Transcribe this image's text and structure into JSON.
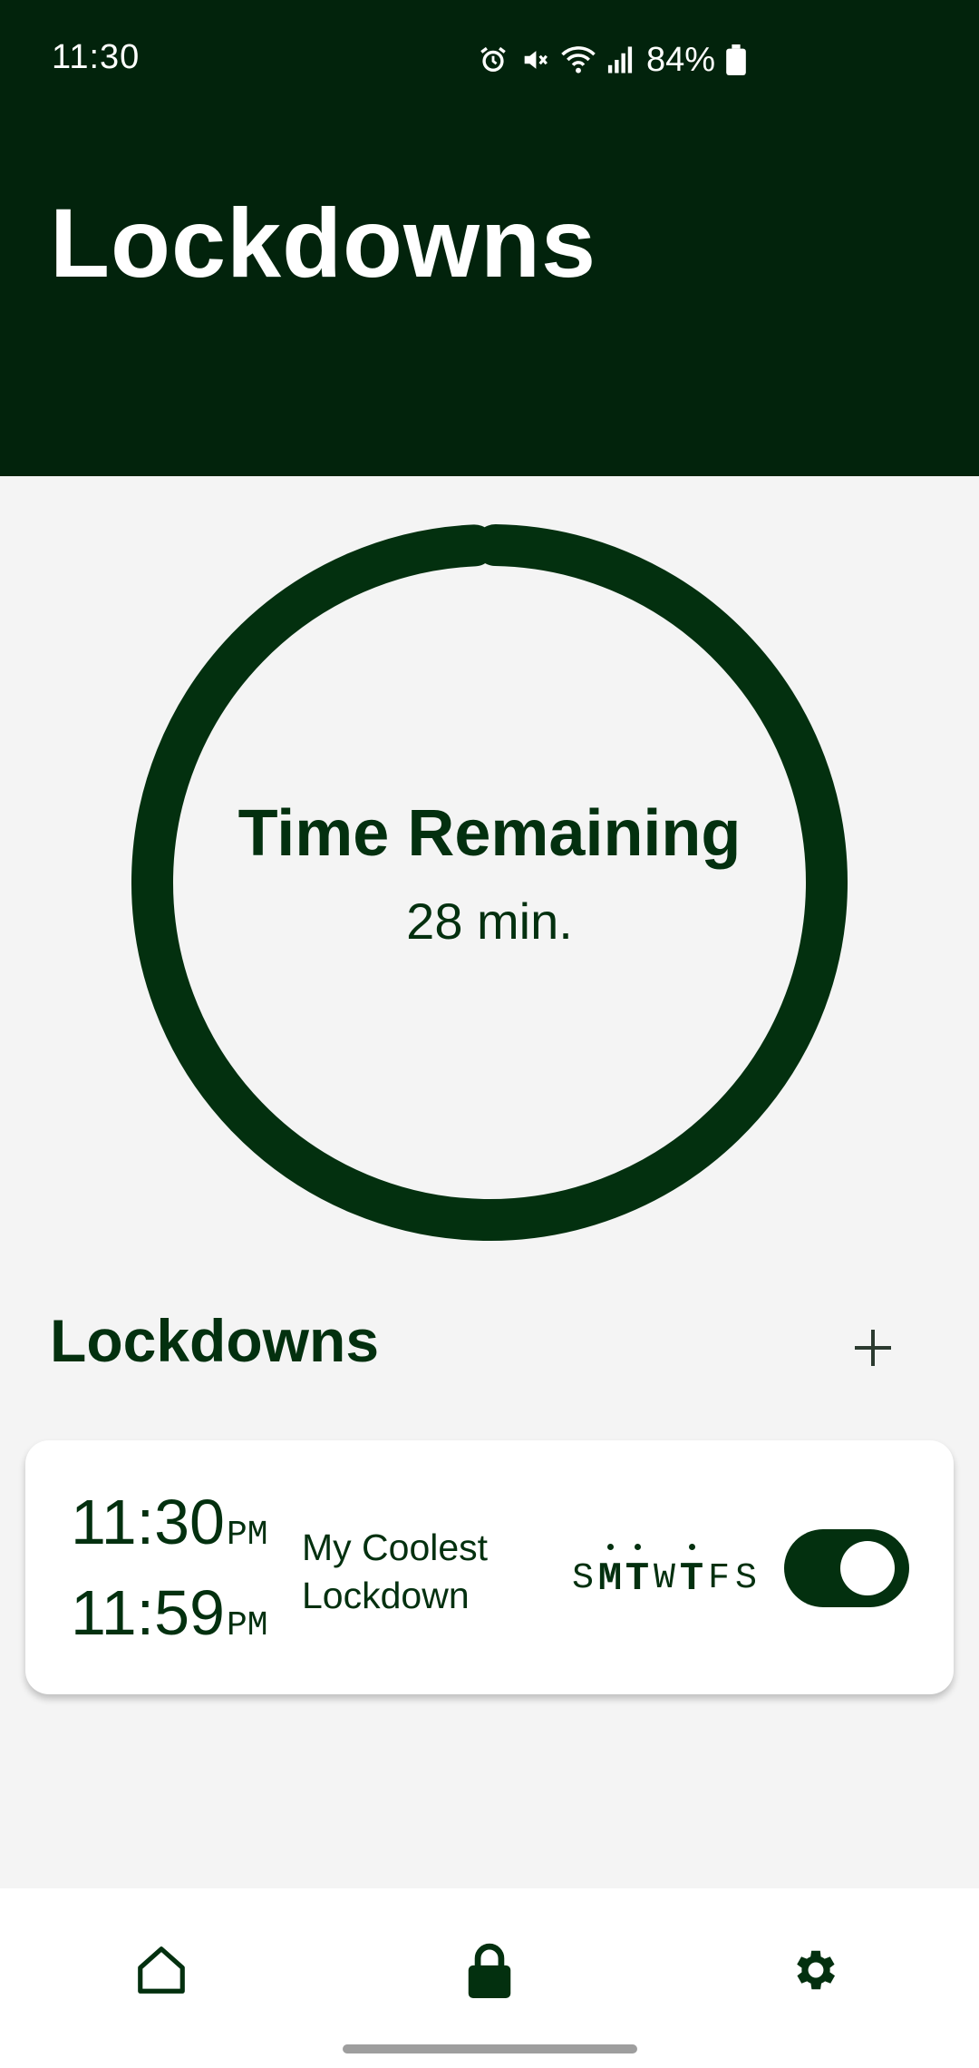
{
  "status_bar": {
    "time": "11:30",
    "battery": "84%",
    "icons": [
      "alarm-icon",
      "mute-icon",
      "wifi-icon",
      "signal-icon",
      "battery-icon"
    ]
  },
  "header": {
    "title": "Lockdowns"
  },
  "timer": {
    "title": "Time Remaining",
    "value": "28 min.",
    "progress": 0.99
  },
  "section": {
    "title": "Lockdowns",
    "add_icon": "plus-icon"
  },
  "lockdown": {
    "start_time": "11:30",
    "start_period": "PM",
    "end_time": "11:59",
    "end_period": "PM",
    "name_line1": "My Coolest",
    "name_line2": "Lockdown",
    "days": [
      {
        "label": "S",
        "active": false
      },
      {
        "label": "M",
        "active": true
      },
      {
        "label": "T",
        "active": true
      },
      {
        "label": "W",
        "active": false
      },
      {
        "label": "T",
        "active": true
      },
      {
        "label": "F",
        "active": false
      },
      {
        "label": "S",
        "active": false
      }
    ],
    "enabled": true
  },
  "bottom_nav": {
    "items": [
      "home-icon",
      "lock-icon",
      "gear-icon"
    ]
  },
  "colors": {
    "header_bg": "#02230c",
    "accent": "#03300f",
    "background": "#f4f4f4",
    "card": "#ffffff"
  }
}
